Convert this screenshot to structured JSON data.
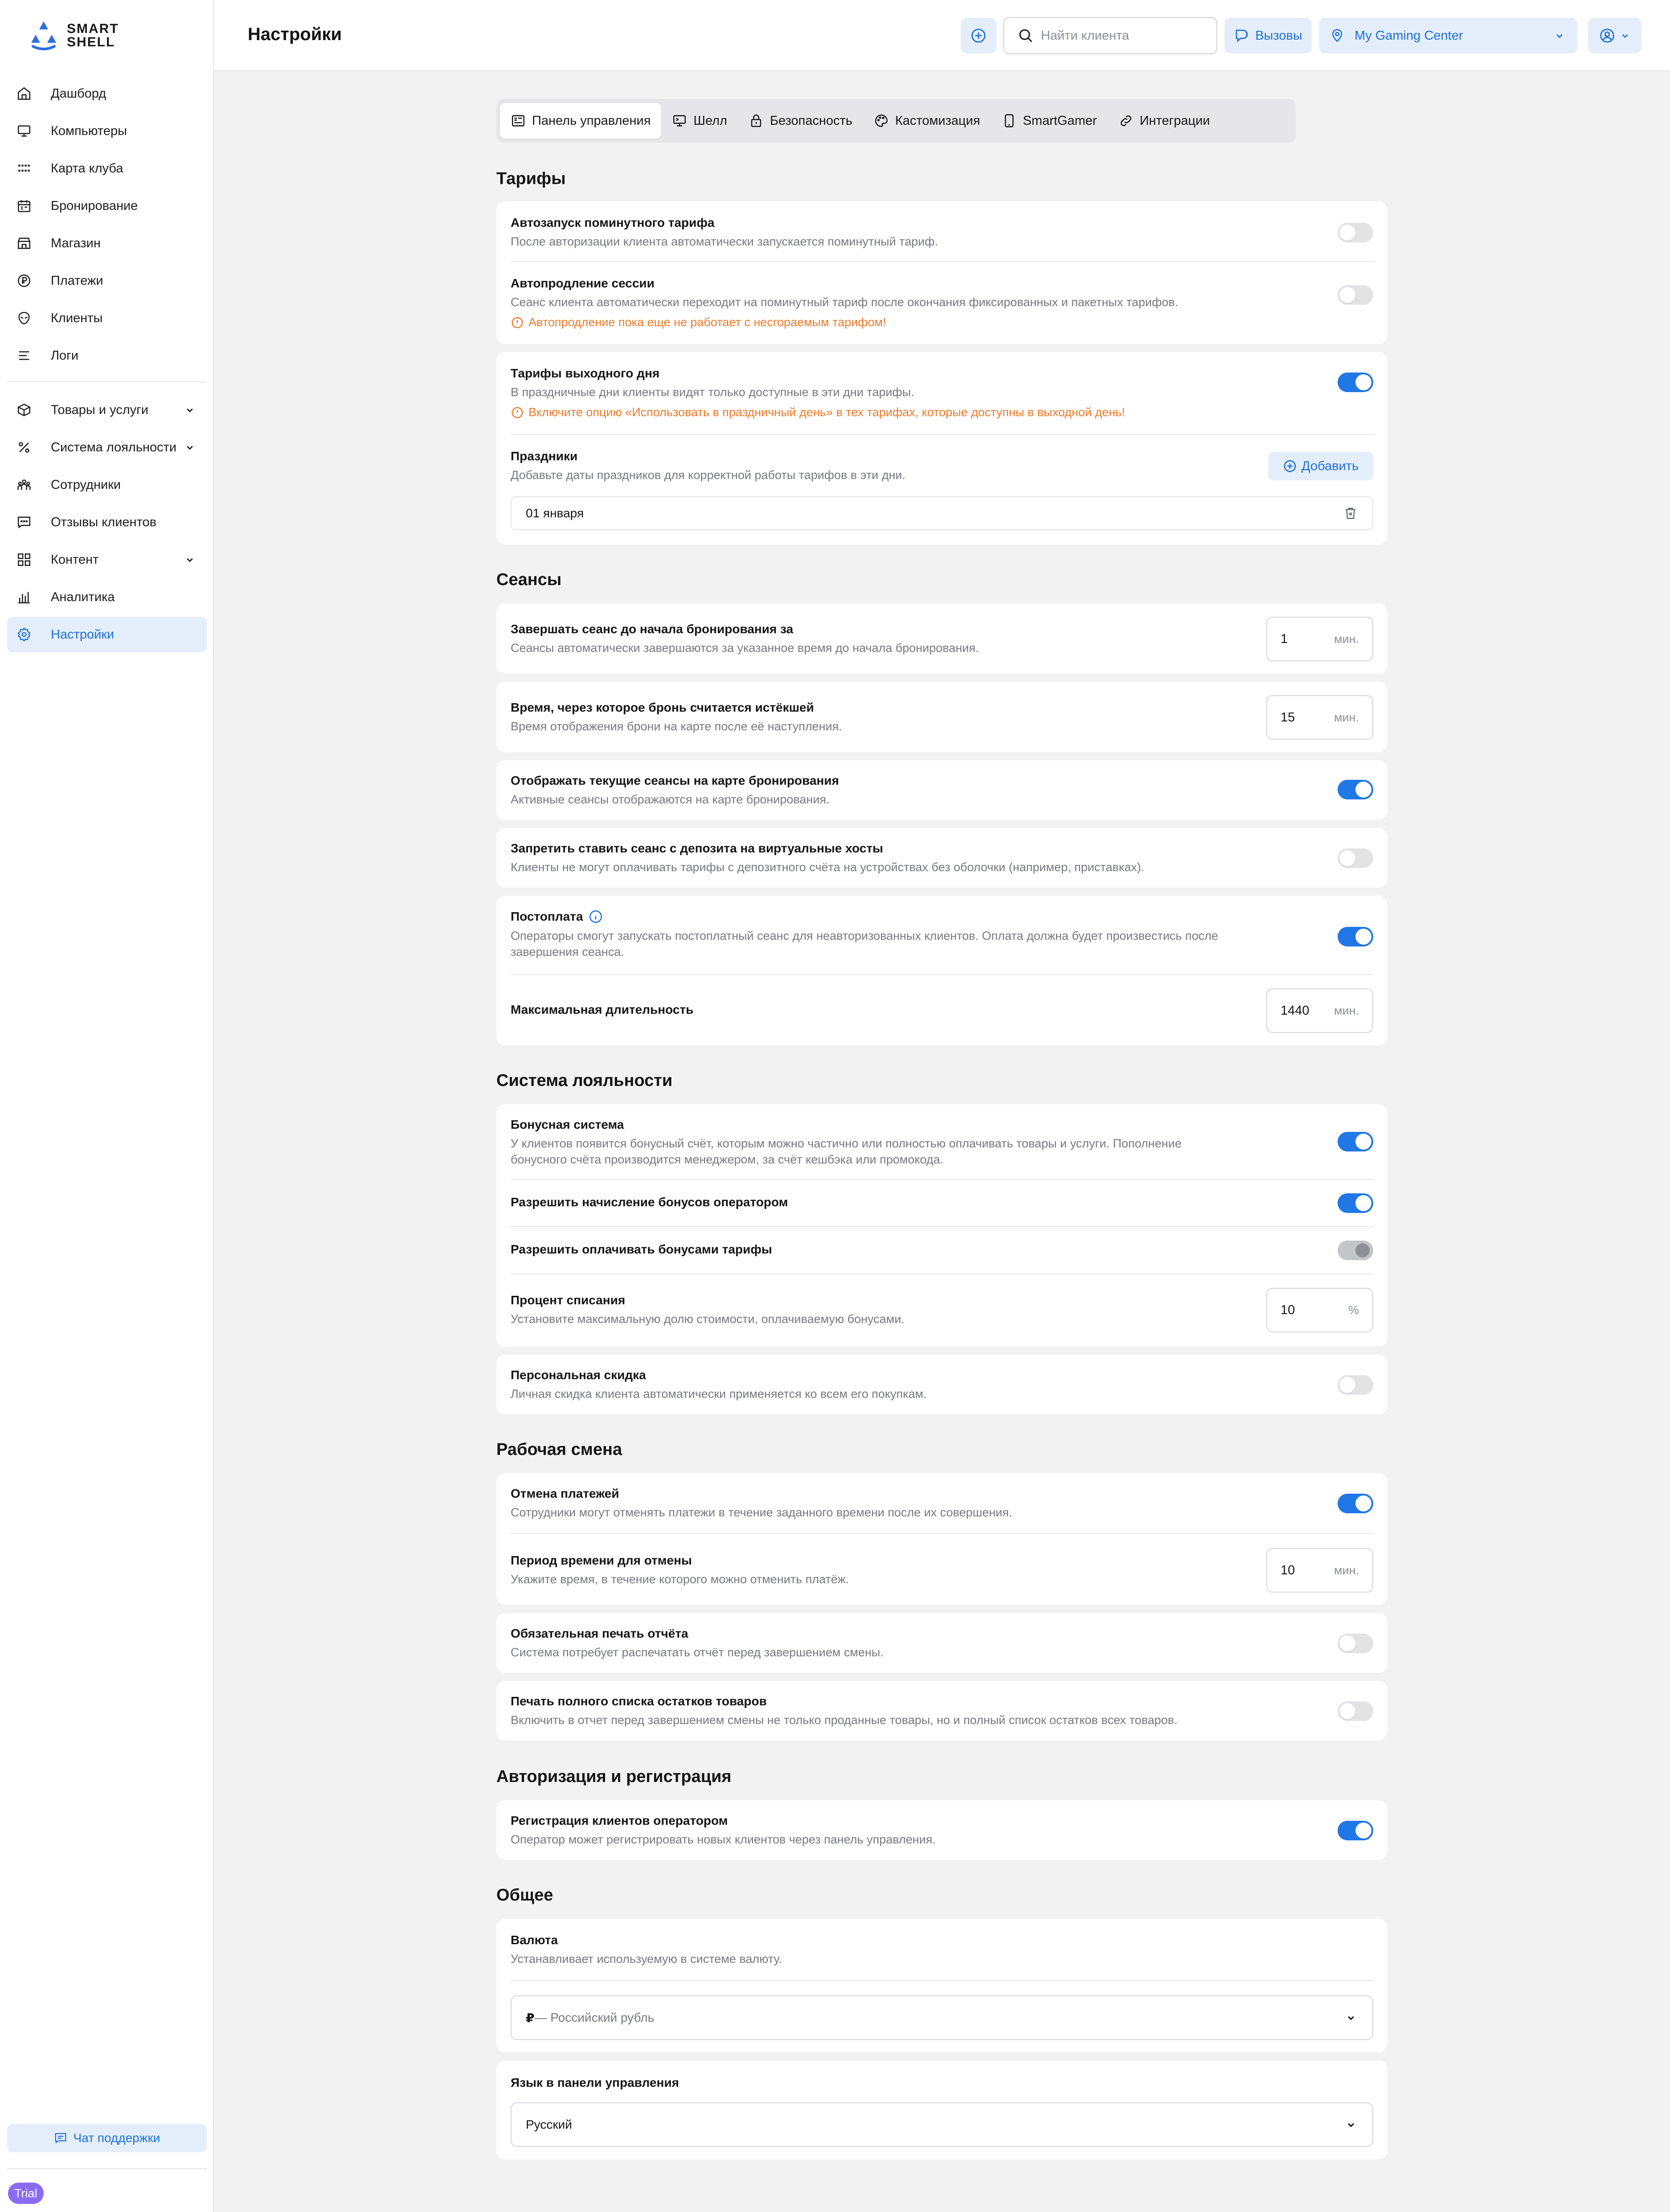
{
  "brand": {
    "name_line1": "SMART",
    "name_line2": "SHELL"
  },
  "sidebar": {
    "items": [
      {
        "label": "Дашборд",
        "icon": "home-icon"
      },
      {
        "label": "Компьютеры",
        "icon": "monitor-icon"
      },
      {
        "label": "Карта клуба",
        "icon": "map-grid-icon"
      },
      {
        "label": "Бронирование",
        "icon": "calendar-icon"
      },
      {
        "label": "Магазин",
        "icon": "store-icon"
      },
      {
        "label": "Платежи",
        "icon": "ruble-icon"
      },
      {
        "label": "Клиенты",
        "icon": "alien-icon"
      },
      {
        "label": "Логи",
        "icon": "logs-icon"
      }
    ],
    "items2": [
      {
        "label": "Товары и услуги",
        "icon": "box-icon",
        "expandable": true
      },
      {
        "label": "Система лояльности",
        "icon": "percent-icon",
        "expandable": true
      },
      {
        "label": "Сотрудники",
        "icon": "team-icon"
      },
      {
        "label": "Отзывы клиентов",
        "icon": "reviews-icon"
      },
      {
        "label": "Контент",
        "icon": "content-grid-icon",
        "expandable": true
      },
      {
        "label": "Аналитика",
        "icon": "chart-icon"
      },
      {
        "label": "Настройки",
        "icon": "gear-icon",
        "active": true
      }
    ],
    "support_label": "Чат поддержки",
    "trial_label": "Trial"
  },
  "header": {
    "title": "Настройки",
    "search_placeholder": "Найти клиента",
    "calls_label": "Вызовы",
    "club_name": "My Gaming Center"
  },
  "tabs": [
    {
      "label": "Панель управления",
      "icon": "dashboard-panel-icon",
      "active": true
    },
    {
      "label": "Шелл",
      "icon": "shell-monitor-icon"
    },
    {
      "label": "Безопасность",
      "icon": "lock-icon"
    },
    {
      "label": "Кастомизация",
      "icon": "palette-icon"
    },
    {
      "label": "SmartGamer",
      "icon": "phone-icon"
    },
    {
      "label": "Интеграции",
      "icon": "link-icon"
    }
  ],
  "tariffs": {
    "title": "Тарифы",
    "autostart": {
      "title": "Автозапуск поминутного тарифа",
      "desc": "После авторизации клиента автоматически запускается поминутный тариф.",
      "enabled": false
    },
    "autoextend": {
      "title": "Автопродление сессии",
      "desc": "Сеанс клиента автоматически переходит на поминутный тариф после окончания фиксированных и пакетных тарифов.",
      "warning": "Автопродление пока еще не работает с несгораемым тарифом!",
      "enabled": false
    },
    "weekend": {
      "title": "Тарифы выходного дня",
      "desc": "В праздничные дни клиенты видят только доступные в эти дни тарифы.",
      "warning": "Включите опцию «Использовать в праздничный день» в тех тарифах, которые доступны в выходной день!",
      "enabled": true
    },
    "holidays": {
      "title": "Праздники",
      "desc": "Добавьте даты праздников для корректной работы тарифов в эти дни.",
      "add_label": "Добавить",
      "items": [
        "01 января"
      ]
    }
  },
  "sessions": {
    "title": "Сеансы",
    "end_before": {
      "title": "Завершать сеанс до начала бронирования за",
      "desc": "Сеансы автоматически завершаются за указанное время до начала бронирования.",
      "value": "1",
      "unit": "мин."
    },
    "expire": {
      "title": "Время, через которое бронь считается истёкшей",
      "desc": "Время отображения брони на карте после её наступления.",
      "value": "15",
      "unit": "мин."
    },
    "show_current": {
      "title": "Отображать текущие сеансы на карте бронирования",
      "desc": "Активные сеансы отображаются на карте бронирования.",
      "enabled": true
    },
    "deny_virtual": {
      "title": "Запретить ставить сеанс с депозита на виртуальные хосты",
      "desc": "Клиенты не могут оплачивать тарифы с депозитного счёта на устройствах без оболочки (например, приставках).",
      "enabled": false
    },
    "postpay": {
      "title": "Постоплата",
      "desc_line1": "Операторы смогут запускать постоплатный сеанс для неавторизованных клиентов. Оплата должна будет произвестись после",
      "desc_line2": "завершения сеанса.",
      "enabled": true
    },
    "max_duration": {
      "title": "Максимальная длительность",
      "value": "1440",
      "unit": "мин."
    }
  },
  "loyalty": {
    "title": "Система лояльности",
    "bonus": {
      "title": "Бонусная система",
      "desc_line1": "У клиентов появится бонусный счёт, которым можно частично или полностью оплачивать товары и услуги. Пополнение",
      "desc_line2": "бонусного счёта производится менеджером, за счёт кешбэка или промокода.",
      "enabled": true
    },
    "operator_bonus": {
      "title": "Разрешить начисление бонусов оператором",
      "enabled": true
    },
    "pay_tariffs": {
      "title": "Разрешить оплачивать бонусами тарифы",
      "enabled": "disabled"
    },
    "percent": {
      "title": "Процент списания",
      "desc": "Установите максимальную долю стоимости, оплачиваемую бонусами.",
      "value": "10",
      "unit": "%"
    },
    "personal": {
      "title": "Персональная скидка",
      "desc": "Личная скидка клиента автоматически применяется ко всем его покупкам.",
      "enabled": false
    }
  },
  "shift": {
    "title": "Рабочая смена",
    "cancel": {
      "title": "Отмена платежей",
      "desc": "Сотрудники могут отменять платежи в течение заданного времени после их совершения.",
      "enabled": true
    },
    "cancel_period": {
      "title": "Период времени для отмены",
      "desc": "Укажите время, в течение которого можно отменить платёж.",
      "value": "10",
      "unit": "мин."
    },
    "print_report": {
      "title": "Обязательная печать отчёта",
      "desc": "Система потребует распечатать отчёт перед завершением смены.",
      "enabled": false
    },
    "print_stock": {
      "title": "Печать полного списка остатков товаров",
      "desc": "Включить в отчет перед завершением смены не только проданные товары, но и полный список остатков всех товаров.",
      "enabled": false
    }
  },
  "auth": {
    "title": "Авторизация и регистрация",
    "operator_reg": {
      "title": "Регистрация клиентов оператором",
      "desc": "Оператор может регистрировать новых клиентов через панель управления.",
      "enabled": true
    }
  },
  "general": {
    "title": "Общее",
    "currency": {
      "title": "Валюта",
      "desc": "Устанавливает используемую в системе валюту.",
      "symbol": "₽",
      "value": " — Российский рубль"
    },
    "language": {
      "title": "Язык в панели управления",
      "value": "Русский"
    }
  },
  "colors": {
    "accent": "#1f78e6",
    "accent_bg": "#e4eefb",
    "warning": "#f07a2a",
    "trial": "#8b6cf0"
  }
}
